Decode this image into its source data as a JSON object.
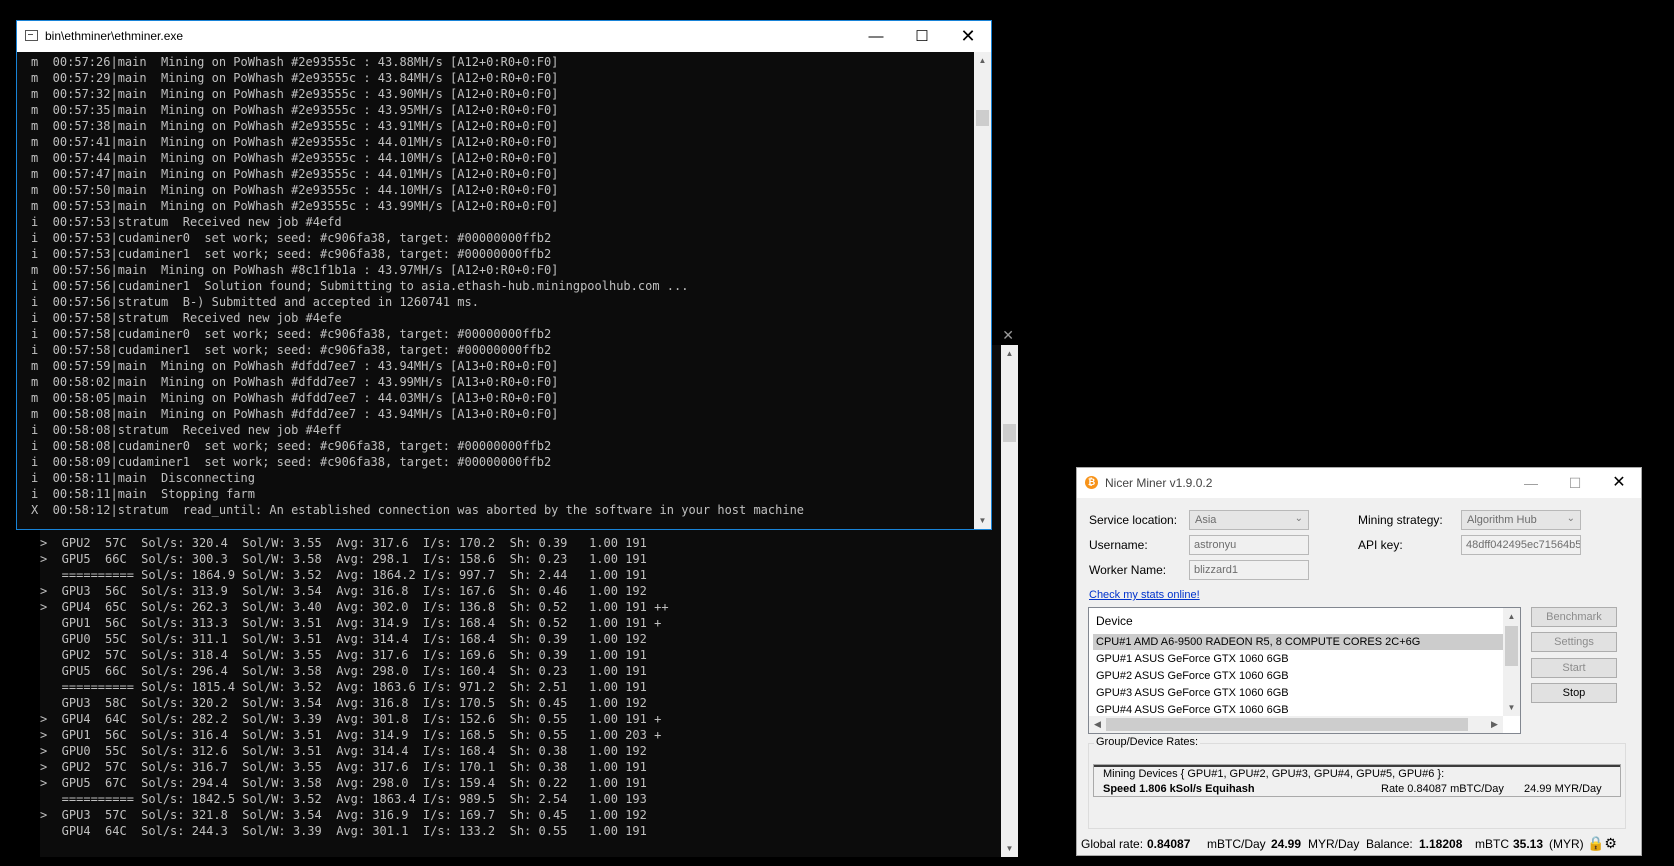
{
  "bg_console": {
    "lines": [
      ">  GPU2  57C  Sol/s: 320.4  Sol/W: 3.55  Avg: 317.6  I/s: 170.2  Sh: 0.39   1.00 191",
      ">  GPU5  66C  Sol/s: 300.3  Sol/W: 3.58  Avg: 298.1  I/s: 158.6  Sh: 0.23   1.00 191",
      "   ========== Sol/s: 1864.9 Sol/W: 3.52  Avg: 1864.2 I/s: 997.7  Sh: 2.44   1.00 191",
      ">  GPU3  56C  Sol/s: 313.9  Sol/W: 3.54  Avg: 316.8  I/s: 167.6  Sh: 0.46   1.00 192",
      ">  GPU4  65C  Sol/s: 262.3  Sol/W: 3.40  Avg: 302.0  I/s: 136.8  Sh: 0.52   1.00 191 ++",
      "   GPU1  56C  Sol/s: 313.3  Sol/W: 3.51  Avg: 314.9  I/s: 168.4  Sh: 0.52   1.00 191 +",
      "   GPU0  55C  Sol/s: 311.1  Sol/W: 3.51  Avg: 314.4  I/s: 168.4  Sh: 0.39   1.00 192",
      "   GPU2  57C  Sol/s: 318.4  Sol/W: 3.55  Avg: 317.6  I/s: 169.6  Sh: 0.39   1.00 191",
      "   GPU5  66C  Sol/s: 296.4  Sol/W: 3.58  Avg: 298.0  I/s: 160.4  Sh: 0.23   1.00 191",
      "   ========== Sol/s: 1815.4 Sol/W: 3.52  Avg: 1863.6 I/s: 971.2  Sh: 2.51   1.00 191",
      "   GPU3  58C  Sol/s: 320.2  Sol/W: 3.54  Avg: 316.8  I/s: 170.5  Sh: 0.45   1.00 192",
      ">  GPU4  64C  Sol/s: 282.2  Sol/W: 3.39  Avg: 301.8  I/s: 152.6  Sh: 0.55   1.00 191 +",
      ">  GPU1  56C  Sol/s: 316.4  Sol/W: 3.51  Avg: 314.9  I/s: 168.5  Sh: 0.55   1.00 203 +",
      ">  GPU0  55C  Sol/s: 312.6  Sol/W: 3.51  Avg: 314.4  I/s: 168.4  Sh: 0.38   1.00 192",
      ">  GPU2  57C  Sol/s: 316.7  Sol/W: 3.55  Avg: 317.6  I/s: 170.1  Sh: 0.38   1.00 191",
      ">  GPU5  67C  Sol/s: 294.4  Sol/W: 3.58  Avg: 298.0  I/s: 159.4  Sh: 0.22   1.00 191",
      "   ========== Sol/s: 1842.5 Sol/W: 3.52  Avg: 1863.4 I/s: 989.5  Sh: 2.54   1.00 193",
      ">  GPU3  57C  Sol/s: 321.8  Sol/W: 3.54  Avg: 316.9  I/s: 169.7  Sh: 0.45   1.00 192",
      "   GPU4  64C  Sol/s: 244.3  Sol/W: 3.39  Avg: 301.1  I/s: 133.2  Sh: 0.55   1.00 191"
    ]
  },
  "ethminer": {
    "title": "bin\\ethminer\\ethminer.exe",
    "lines": [
      "m  00:57:26|main  Mining on PoWhash #2e93555c : 43.88MH/s [A12+0:R0+0:F0]",
      "m  00:57:29|main  Mining on PoWhash #2e93555c : 43.84MH/s [A12+0:R0+0:F0]",
      "m  00:57:32|main  Mining on PoWhash #2e93555c : 43.90MH/s [A12+0:R0+0:F0]",
      "m  00:57:35|main  Mining on PoWhash #2e93555c : 43.95MH/s [A12+0:R0+0:F0]",
      "m  00:57:38|main  Mining on PoWhash #2e93555c : 43.91MH/s [A12+0:R0+0:F0]",
      "m  00:57:41|main  Mining on PoWhash #2e93555c : 44.01MH/s [A12+0:R0+0:F0]",
      "m  00:57:44|main  Mining on PoWhash #2e93555c : 44.10MH/s [A12+0:R0+0:F0]",
      "m  00:57:47|main  Mining on PoWhash #2e93555c : 44.01MH/s [A12+0:R0+0:F0]",
      "m  00:57:50|main  Mining on PoWhash #2e93555c : 44.10MH/s [A12+0:R0+0:F0]",
      "m  00:57:53|main  Mining on PoWhash #2e93555c : 43.99MH/s [A12+0:R0+0:F0]",
      "i  00:57:53|stratum  Received new job #4efd",
      "i  00:57:53|cudaminer0  set work; seed: #c906fa38, target: #00000000ffb2",
      "i  00:57:53|cudaminer1  set work; seed: #c906fa38, target: #00000000ffb2",
      "m  00:57:56|main  Mining on PoWhash #8c1f1b1a : 43.97MH/s [A12+0:R0+0:F0]",
      "i  00:57:56|cudaminer1  Solution found; Submitting to asia.ethash-hub.miningpoolhub.com ...",
      "i  00:57:56|stratum  B-) Submitted and accepted in 1260741 ms.",
      "i  00:57:58|stratum  Received new job #4efe",
      "i  00:57:58|cudaminer0  set work; seed: #c906fa38, target: #00000000ffb2",
      "i  00:57:58|cudaminer1  set work; seed: #c906fa38, target: #00000000ffb2",
      "m  00:57:59|main  Mining on PoWhash #dfdd7ee7 : 43.94MH/s [A13+0:R0+0:F0]",
      "m  00:58:02|main  Mining on PoWhash #dfdd7ee7 : 43.99MH/s [A13+0:R0+0:F0]",
      "m  00:58:05|main  Mining on PoWhash #dfdd7ee7 : 44.03MH/s [A13+0:R0+0:F0]",
      "m  00:58:08|main  Mining on PoWhash #dfdd7ee7 : 43.94MH/s [A13+0:R0+0:F0]",
      "i  00:58:08|stratum  Received new job #4eff",
      "i  00:58:08|cudaminer0  set work; seed: #c906fa38, target: #00000000ffb2",
      "i  00:58:09|cudaminer1  set work; seed: #c906fa38, target: #00000000ffb2",
      "i  00:58:11|main  Disconnecting",
      "i  00:58:11|main  Stopping farm",
      "X  00:58:12|stratum  read_until: An established connection was aborted by the software in your host machine"
    ]
  },
  "nicer": {
    "title": "Nicer Miner v1.9.0.2",
    "service_location_label": "Service location:",
    "service_location_value": "Asia",
    "mining_strategy_label": "Mining strategy:",
    "mining_strategy_value": "Algorithm Hub",
    "username_label": "Username:",
    "username_value": "astronyu",
    "api_key_label": "API key:",
    "api_key_value": "48dff042495ec71564b5",
    "worker_label": "Worker Name:",
    "worker_value": "blizzard1",
    "stats_link": "Check my stats online!",
    "device_header": "Device",
    "devices": [
      "CPU#1 AMD A6-9500 RADEON R5, 8 COMPUTE CORES 2C+6G",
      "GPU#1 ASUS GeForce GTX 1060 6GB",
      "GPU#2 ASUS GeForce GTX 1060 6GB",
      "GPU#3 ASUS GeForce GTX 1060 6GB",
      "GPU#4 ASUS GeForce GTX 1060 6GB"
    ],
    "buttons": {
      "benchmark": "Benchmark",
      "settings": "Settings",
      "start": "Start",
      "stop": "Stop"
    },
    "rates_legend": "Group/Device Rates:",
    "mining_devices": "Mining Devices { GPU#1, GPU#2, GPU#3, GPU#4, GPU#5, GPU#6 }:",
    "speed": "Speed    1.806 kSol/s Equihash",
    "rate": "Rate     0.84087 mBTC/Day",
    "rate_myr": "24.99 MYR/Day",
    "status": {
      "global_label": "Global rate:",
      "global_value": "0.84087",
      "global_unit": "mBTC/Day",
      "myr_value": "24.99",
      "myr_unit": "MYR/Day",
      "balance_label": "Balance:",
      "balance_value": "1.18208",
      "balance_unit": "mBTC",
      "balance_myr": "35.13",
      "balance_myr_unit": "(MYR)"
    }
  }
}
